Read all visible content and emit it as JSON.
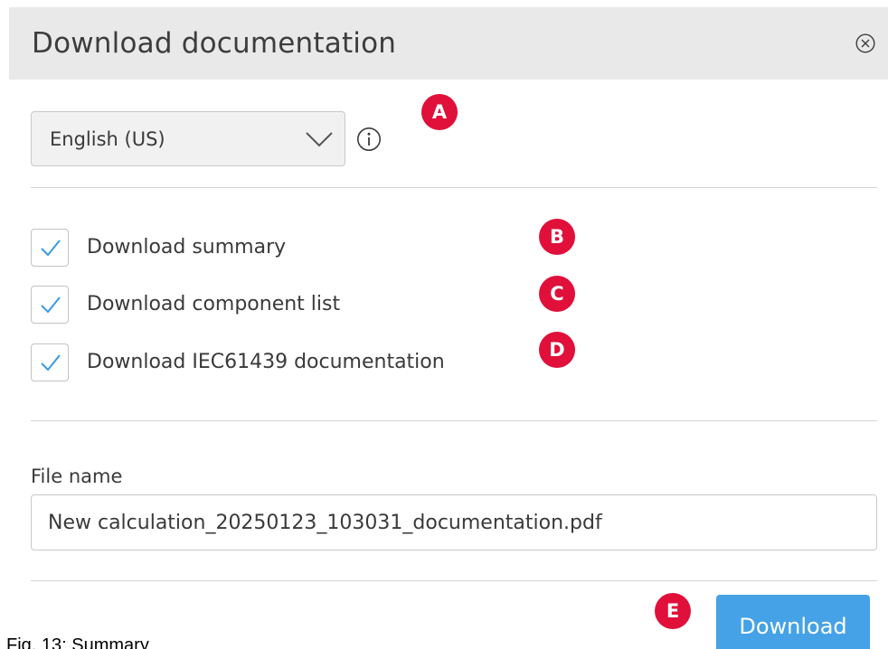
{
  "dialog": {
    "title": "Download documentation",
    "close_icon": "close-circle-icon"
  },
  "language": {
    "selected": "English (US)",
    "dropdown_icon": "chevron-down-icon",
    "info_icon": "info-circle-icon"
  },
  "options": [
    {
      "label": "Download summary",
      "checked": true
    },
    {
      "label": "Download component list",
      "checked": true
    },
    {
      "label": "Download IEC61439 documentation",
      "checked": true
    }
  ],
  "file": {
    "label": "File name",
    "value": "New calculation_20250123_103031_documentation.pdf"
  },
  "actions": {
    "download_label": "Download"
  },
  "markers": [
    "A",
    "B",
    "C",
    "D",
    "E"
  ],
  "caption": "Fig. 13: Summary",
  "colors": {
    "header_bg": "#e9e9e9",
    "accent": "#45a2e6",
    "check": "#3a9ae0",
    "marker": "#e0103a"
  }
}
